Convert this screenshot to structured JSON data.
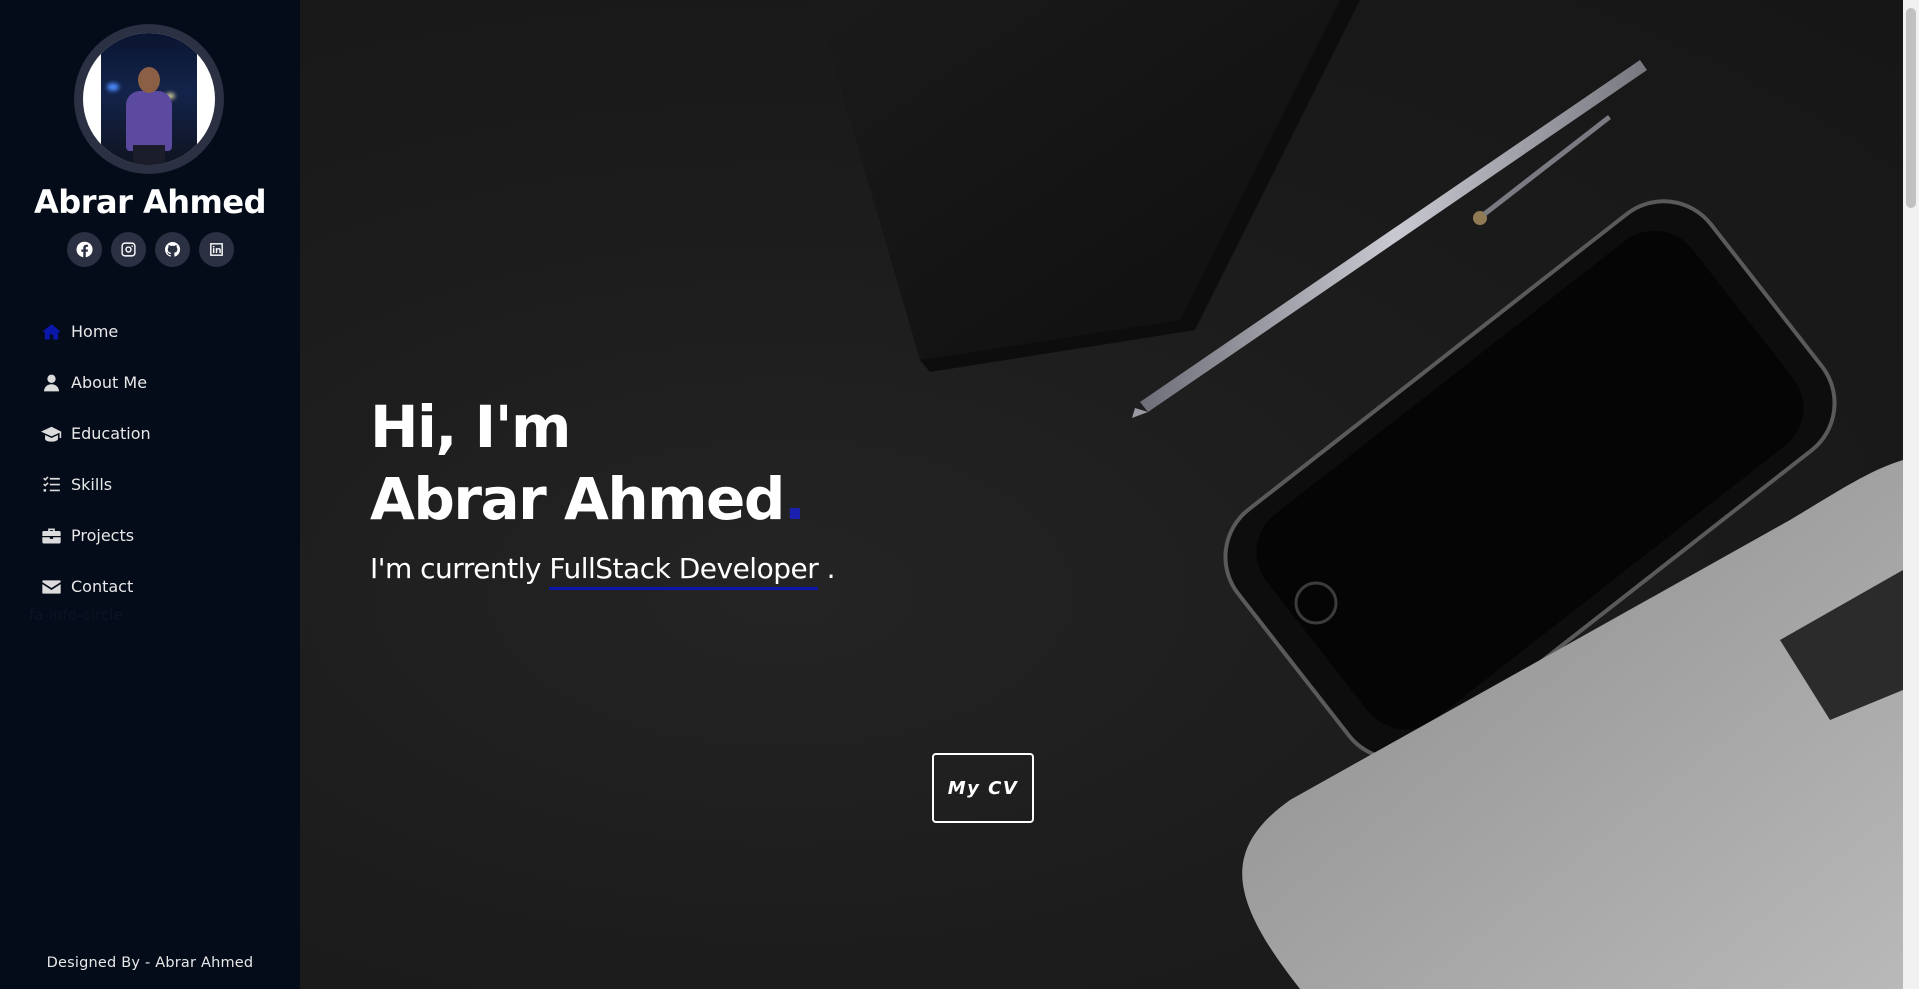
{
  "sidebar": {
    "profile_name": "Abrar Ahmed",
    "socials": [
      {
        "icon": "facebook-icon"
      },
      {
        "icon": "instagram-icon"
      },
      {
        "icon": "github-icon"
      },
      {
        "icon": "linkedin-icon"
      }
    ],
    "nav": [
      {
        "label": "Home",
        "icon": "home-icon",
        "active": true
      },
      {
        "label": "About Me",
        "icon": "user-icon",
        "active": false
      },
      {
        "label": "Education",
        "icon": "graduation-cap-icon",
        "active": false
      },
      {
        "label": "Skills",
        "icon": "list-check-icon",
        "active": false
      },
      {
        "label": "Projects",
        "icon": "briefcase-icon",
        "active": false
      },
      {
        "label": "Contact",
        "icon": "envelope-icon",
        "active": false
      }
    ],
    "stray_text": "fa-info-circle",
    "footer": "Designed By - Abrar Ahmed"
  },
  "hero": {
    "greeting": "Hi, I'm",
    "name": "Abrar Ahmed",
    "name_dot": ".",
    "subtitle_prefix": "I'm currently",
    "subtitle_role": "FullStack Developer",
    "subtitle_suffix": " .",
    "cv_button": "My CV"
  },
  "colors": {
    "sidebar_bg": "#040b19",
    "accent": "#0b17a8",
    "icon_circle": "#2b3042"
  }
}
